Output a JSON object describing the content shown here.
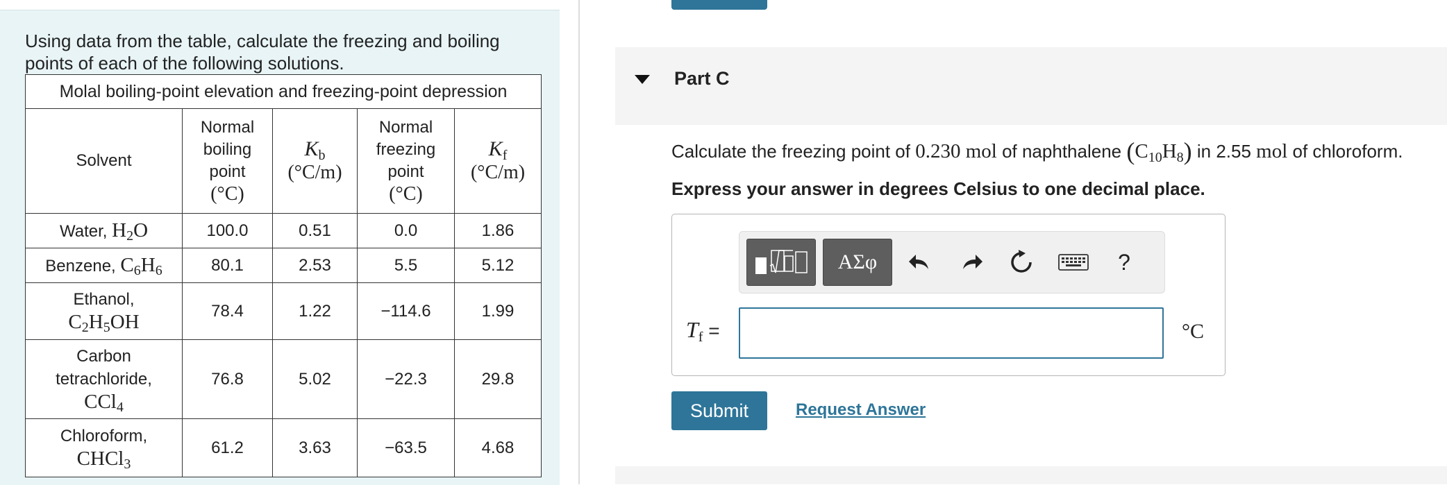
{
  "left_panel": {
    "intro": "Using data from the table, calculate the freezing and boiling points of each of the following solutions.",
    "table": {
      "caption": "Molal boiling-point elevation and freezing-point depression",
      "headers": {
        "solvent": "Solvent",
        "bp_line1": "Normal",
        "bp_line2": "boiling",
        "bp_line3": "point",
        "bp_unit": "(°C)",
        "kb_symbol": "K",
        "kb_sub": "b",
        "kb_unit": "(°C/m)",
        "fp_line1": "Normal",
        "fp_line2": "freezing",
        "fp_line3": "point",
        "fp_unit": "(°C)",
        "kf_symbol": "K",
        "kf_sub": "f",
        "kf_unit": "(°C/m)"
      },
      "rows": [
        {
          "name": "Water, ",
          "bp": "100.0",
          "kb": "0.51",
          "fp": "0.0",
          "kf": "1.86"
        },
        {
          "name": "Benzene, ",
          "bp": "80.1",
          "kb": "2.53",
          "fp": "5.5",
          "kf": "5.12"
        },
        {
          "name": "Ethanol,",
          "bp": "78.4",
          "kb": "1.22",
          "fp": "−114.6",
          "kf": "1.99"
        },
        {
          "name_line1": "Carbon",
          "name_line2": "tetrachloride,",
          "bp": "76.8",
          "kb": "5.02",
          "fp": "−22.3",
          "kf": "29.8"
        },
        {
          "name": "Chloroform,",
          "bp": "61.2",
          "kb": "3.63",
          "fp": "−63.5",
          "kf": "4.68"
        }
      ]
    }
  },
  "part": {
    "title": "Part C",
    "question": {
      "prefix": "Calculate the freezing point of ",
      "amount1": "0.230 mol",
      "middle": " of naphthalene ",
      "in_text": " in 2.55 ",
      "amount2_unit": "mol",
      "suffix": " of chloroform."
    },
    "instruction": "Express your answer in degrees Celsius to one decimal place.",
    "toolbar": {
      "templates_icon": "templates-icon",
      "symbols_label": "ΑΣφ",
      "undo_icon": "undo-icon",
      "redo_icon": "redo-icon",
      "reset_icon": "reset-icon",
      "keyboard_icon": "keyboard-icon",
      "help_label": "?"
    },
    "answer": {
      "variable": "T",
      "variable_sub": "f",
      "equals": "=",
      "value": "",
      "unit": "°C"
    },
    "submit_label": "Submit",
    "request_answer_label": "Request Answer"
  },
  "colors": {
    "panel_bg": "#e8f4f6",
    "accent": "#2e7599",
    "toolbar_button": "#5e5e5e",
    "header_bg": "#f4f4f4"
  }
}
